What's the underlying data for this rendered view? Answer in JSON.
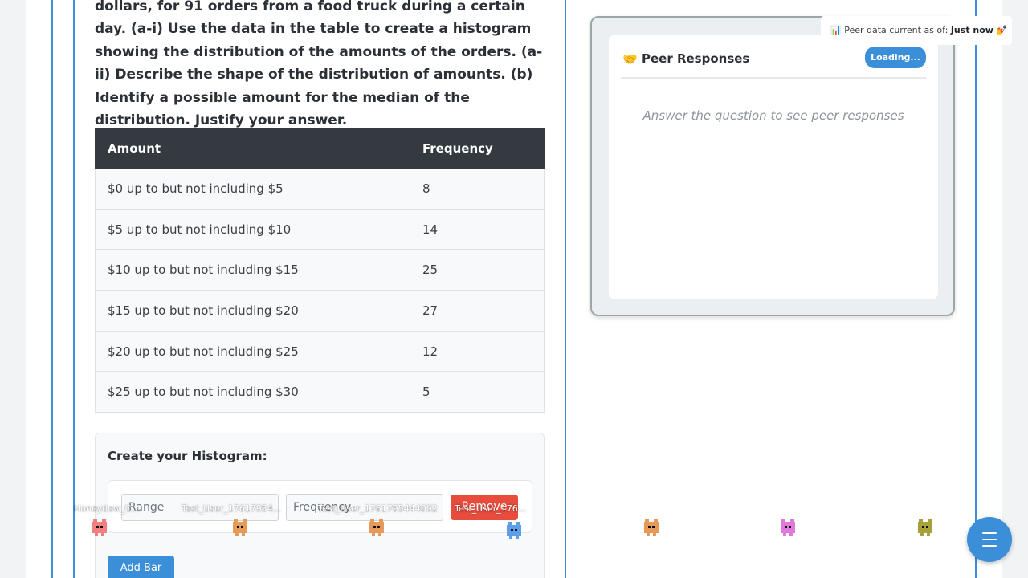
{
  "question": {
    "text": "dollars, for 91 orders from a food truck during a certain day. (a-i) Use the data in the table to create a histogram showing the distribution of the amounts of the orders. (a-ii) Describe the shape of the distribution of amounts. (b) Identify a possible amount for the median of the distribution. Justify your answer."
  },
  "table": {
    "headers": [
      "Amount",
      "Frequency"
    ],
    "rows": [
      [
        "$0 up to but not including $5",
        "8"
      ],
      [
        "$5 up to but not including $10",
        "14"
      ],
      [
        "$10 up to but not including $15",
        "25"
      ],
      [
        "$15 up to but not including $20",
        "27"
      ],
      [
        "$20 up to but not including $25",
        "12"
      ],
      [
        "$25 up to but not including $30",
        "5"
      ]
    ]
  },
  "histogram_builder": {
    "title": "Create your Histogram:",
    "range_placeholder": "Range",
    "frequency_placeholder": "Frequency",
    "remove_label": "Remove",
    "add_bar_label": "Add Bar"
  },
  "peer_panel": {
    "title": "Peer Responses",
    "emoji": "🤝",
    "loading_label": "Loading...",
    "empty_message": "Answer the question to see peer responses",
    "status_prefix": "Peer data current as of:",
    "status_time": "Just now",
    "status_icon_left": "📊",
    "status_icon_right": "💅"
  },
  "pets": [
    {
      "label": "Honeydew_C...",
      "color": "#f08080",
      "name": "pet-pink"
    },
    {
      "label": "Test_User_17617954...",
      "color": "#e69a5a",
      "name": "pet-orange-1"
    },
    {
      "label": "Test_User_1761795444002",
      "color": "#e69a5a",
      "name": "pet-orange-2"
    },
    {
      "label": "Test_User_176...",
      "color": "#5d9ee8",
      "name": "pet-blue"
    },
    {
      "label": "",
      "color": "#e69a5a",
      "name": "pet-orange-3"
    },
    {
      "label": "",
      "color": "#e07ad8",
      "name": "pet-magenta"
    },
    {
      "label": "",
      "color": "#a8a03a",
      "name": "pet-olive"
    }
  ],
  "colors": {
    "accent": "#3b8fd9",
    "danger": "#e74c3c",
    "table_header": "#343a40"
  },
  "icons": {
    "fab": "menu-icon"
  }
}
